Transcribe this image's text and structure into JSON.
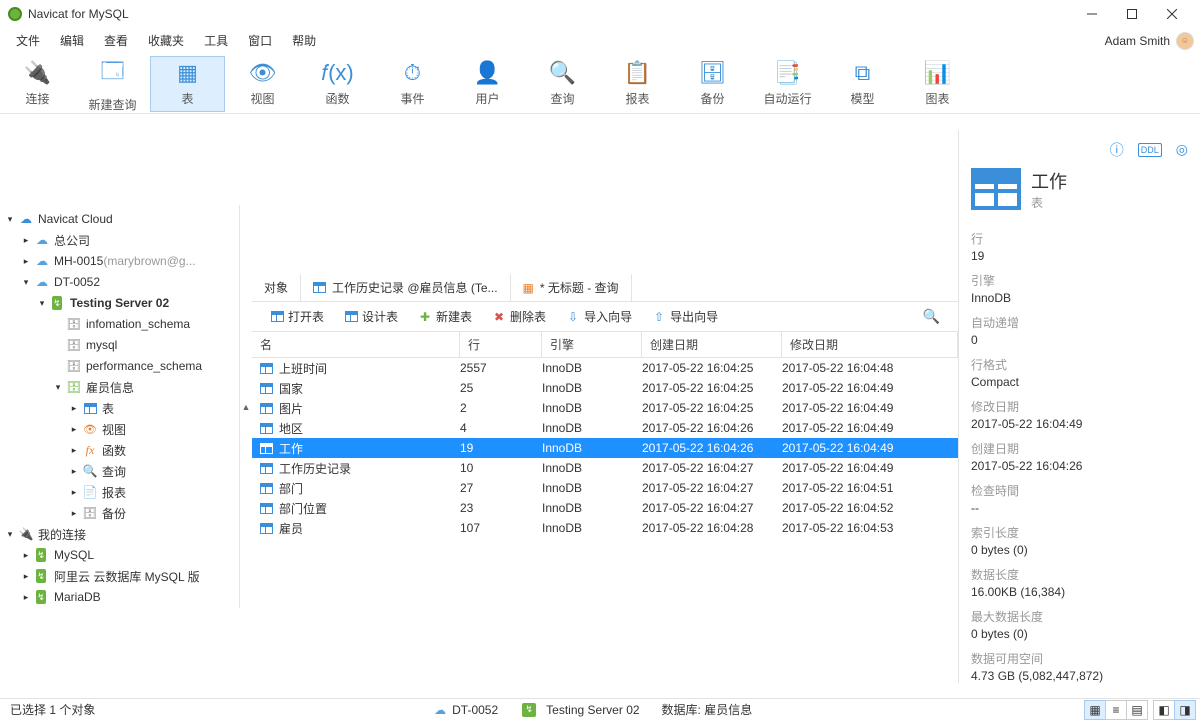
{
  "window": {
    "title": "Navicat for MySQL"
  },
  "menu": [
    "文件",
    "编辑",
    "查看",
    "收藏夹",
    "工具",
    "窗口",
    "帮助"
  ],
  "user": "Adam Smith",
  "toolbar": [
    {
      "label": "连接",
      "icon": "plug"
    },
    {
      "label": "新建查询",
      "icon": "newquery"
    },
    {
      "label": "表",
      "icon": "table",
      "active": true
    },
    {
      "label": "视图",
      "icon": "view"
    },
    {
      "label": "函数",
      "icon": "fx"
    },
    {
      "label": "事件",
      "icon": "event"
    },
    {
      "label": "用户",
      "icon": "user"
    },
    {
      "label": "查询",
      "icon": "query"
    },
    {
      "label": "报表",
      "icon": "report"
    },
    {
      "label": "备份",
      "icon": "backup"
    },
    {
      "label": "自动运行",
      "icon": "schedule"
    },
    {
      "label": "模型",
      "icon": "model"
    },
    {
      "label": "图表",
      "icon": "chart"
    }
  ],
  "tree": {
    "cloud_label": "Navicat Cloud",
    "cloud_children": [
      {
        "label": "总公司"
      },
      {
        "label": "MH-0015",
        "suffix": "(marybrown@g...",
        "gray": true
      },
      {
        "label": "DT-0052",
        "open": true
      }
    ],
    "testing_server": "Testing Server 02",
    "schemas": [
      "infomation_schema",
      "mysql",
      "performance_schema"
    ],
    "db_open": "雇员信息",
    "db_children": [
      "表",
      "视图",
      "函数",
      "查询",
      "报表",
      "备份"
    ],
    "myconn_label": "我的连接",
    "myconn_children": [
      "MySQL",
      "阿里云 云数据库 MySQL 版",
      "MariaDB"
    ]
  },
  "tabs": [
    {
      "label": "对象"
    },
    {
      "label": "工作历史记录 @雇员信息 (Te...",
      "icon": "tbl"
    },
    {
      "label": "* 无标题 - 查询",
      "icon": "query"
    }
  ],
  "ctoolbar": [
    "打开表",
    "设计表",
    "新建表",
    "删除表",
    "导入向导",
    "导出向导"
  ],
  "columns": [
    "名",
    "行",
    "引擎",
    "创建日期",
    "修改日期"
  ],
  "rows": [
    {
      "name": "上班时间",
      "rows": "2557",
      "engine": "InnoDB",
      "created": "2017-05-22 16:04:25",
      "modified": "2017-05-22 16:04:48"
    },
    {
      "name": "国家",
      "rows": "25",
      "engine": "InnoDB",
      "created": "2017-05-22 16:04:25",
      "modified": "2017-05-22 16:04:49"
    },
    {
      "name": "图片",
      "rows": "2",
      "engine": "InnoDB",
      "created": "2017-05-22 16:04:25",
      "modified": "2017-05-22 16:04:49"
    },
    {
      "name": "地区",
      "rows": "4",
      "engine": "InnoDB",
      "created": "2017-05-22 16:04:26",
      "modified": "2017-05-22 16:04:49"
    },
    {
      "name": "工作",
      "rows": "19",
      "engine": "InnoDB",
      "created": "2017-05-22 16:04:26",
      "modified": "2017-05-22 16:04:49",
      "selected": true
    },
    {
      "name": "工作历史记录",
      "rows": "10",
      "engine": "InnoDB",
      "created": "2017-05-22 16:04:27",
      "modified": "2017-05-22 16:04:49"
    },
    {
      "name": "部门",
      "rows": "27",
      "engine": "InnoDB",
      "created": "2017-05-22 16:04:27",
      "modified": "2017-05-22 16:04:51"
    },
    {
      "name": "部门位置",
      "rows": "23",
      "engine": "InnoDB",
      "created": "2017-05-22 16:04:27",
      "modified": "2017-05-22 16:04:52"
    },
    {
      "name": "雇员",
      "rows": "107",
      "engine": "InnoDB",
      "created": "2017-05-22 16:04:28",
      "modified": "2017-05-22 16:04:53"
    }
  ],
  "detail": {
    "title": "工作",
    "subtitle": "表",
    "props": [
      {
        "k": "行",
        "v": "19"
      },
      {
        "k": "引擎",
        "v": "InnoDB"
      },
      {
        "k": "自动递增",
        "v": "0"
      },
      {
        "k": "行格式",
        "v": "Compact"
      },
      {
        "k": "修改日期",
        "v": "2017-05-22 16:04:49"
      },
      {
        "k": "创建日期",
        "v": "2017-05-22 16:04:26"
      },
      {
        "k": "检查時間",
        "v": "--"
      },
      {
        "k": "索引长度",
        "v": "0 bytes (0)"
      },
      {
        "k": "数据长度",
        "v": "16.00KB (16,384)"
      },
      {
        "k": "最大数据长度",
        "v": "0 bytes (0)"
      },
      {
        "k": "数据可用空间",
        "v": "4.73 GB (5,082,447,872)"
      }
    ]
  },
  "status": {
    "left": "已选择 1 个对象",
    "conn": "DT-0052",
    "server": "Testing Server 02",
    "db": "数据库: 雇员信息"
  }
}
